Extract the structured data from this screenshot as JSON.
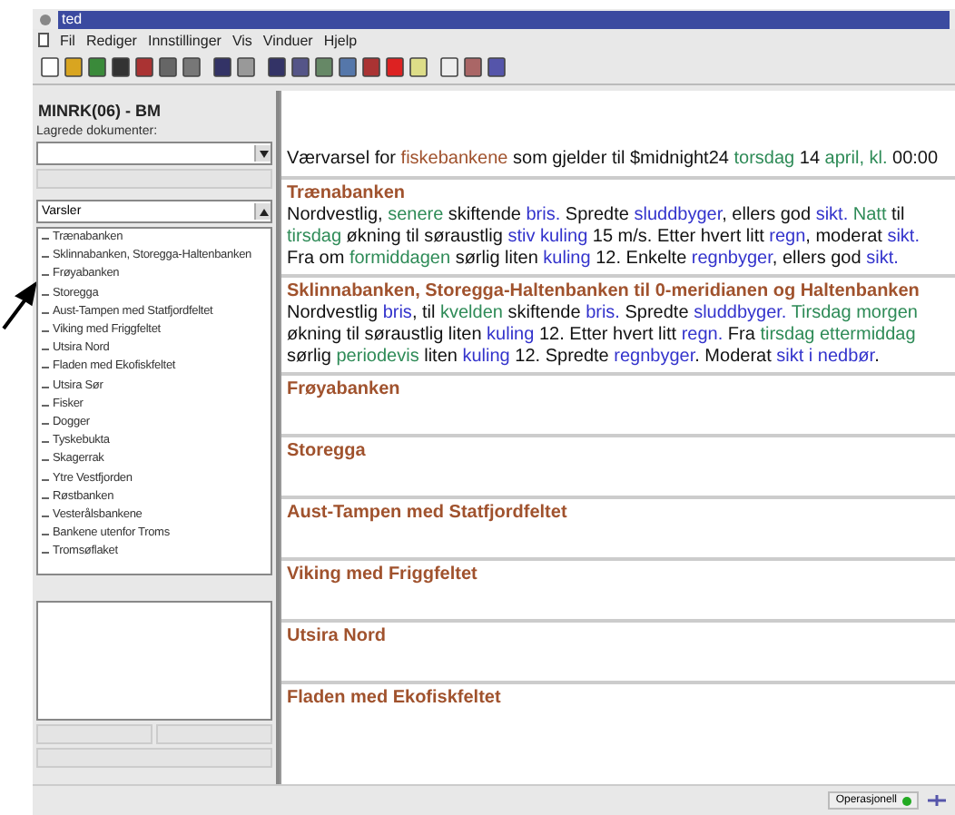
{
  "window": {
    "title": "ted"
  },
  "menu": [
    {
      "label": "Fil"
    },
    {
      "label": "Rediger"
    },
    {
      "label": "Innstillinger"
    },
    {
      "label": "Vis"
    },
    {
      "label": "Vinduer"
    },
    {
      "label": "Hjelp"
    }
  ],
  "sidebar": {
    "title": "MINRK(06) - BM",
    "saved_label": "Lagrede dokumenter:",
    "list_select": "Varsler",
    "tree": [
      {
        "label": "Trænabanken"
      },
      {
        "label": "Sklinnabanken, Storegga-Haltenbanken"
      },
      {
        "label": "Frøyabanken"
      },
      {
        "label": "Storegga"
      },
      {
        "label": "Aust-Tampen med Statfjordfeltet"
      },
      {
        "label": "Viking med Friggfeltet"
      },
      {
        "label": "Utsira Nord"
      },
      {
        "label": "Fladen med Ekofiskfeltet"
      },
      {
        "label": "Utsira Sør"
      },
      {
        "label": "Fisker"
      },
      {
        "label": "Dogger"
      },
      {
        "label": "Tyskebukta"
      },
      {
        "label": "Skagerrak"
      },
      {
        "label": "Ytre Vestfjorden"
      },
      {
        "label": "Røstbanken"
      },
      {
        "label": "Vesterålsbankene"
      },
      {
        "label": "Bankene utenfor Troms"
      },
      {
        "label": "Tromsøflaket"
      }
    ]
  },
  "document": {
    "intro": [
      {
        "kind": "plain",
        "text": "Værvarsel for "
      },
      {
        "kind": "place",
        "text": "fiskebankene"
      },
      {
        "kind": "plain",
        "text": " som gjelder til $midnight24 "
      },
      {
        "kind": "time",
        "text": "torsdag"
      },
      {
        "kind": "plain",
        "text": " 14 "
      },
      {
        "kind": "time",
        "text": "april, kl."
      },
      {
        "kind": "plain",
        "text": " 00:00"
      }
    ],
    "sections": [
      {
        "heading": "Trænabanken",
        "body": [
          {
            "kind": "plain",
            "text": "Nordvestlig, "
          },
          {
            "kind": "time",
            "text": "senere"
          },
          {
            "kind": "plain",
            "text": " skiftende "
          },
          {
            "kind": "term",
            "text": "bris."
          },
          {
            "kind": "plain",
            "text": " Spredte "
          },
          {
            "kind": "term",
            "text": "sluddbyger"
          },
          {
            "kind": "plain",
            "text": ", ellers god "
          },
          {
            "kind": "term",
            "text": "sikt."
          },
          {
            "kind": "time",
            "text": " Natt"
          },
          {
            "kind": "plain",
            "text": " til "
          },
          {
            "kind": "time",
            "text": "tirsdag"
          },
          {
            "kind": "plain",
            "text": " økning til søraustlig "
          },
          {
            "kind": "term",
            "text": "stiv kuling"
          },
          {
            "kind": "plain",
            "text": " 15 m/s. Etter hvert litt "
          },
          {
            "kind": "term",
            "text": "regn"
          },
          {
            "kind": "plain",
            "text": ", moderat "
          },
          {
            "kind": "term",
            "text": "sikt."
          },
          {
            "kind": "plain",
            "text": " Fra om "
          },
          {
            "kind": "time",
            "text": "formiddagen"
          },
          {
            "kind": "plain",
            "text": " sørlig liten "
          },
          {
            "kind": "term",
            "text": "kuling"
          },
          {
            "kind": "plain",
            "text": " 12. Enkelte "
          },
          {
            "kind": "term",
            "text": "regnbyger"
          },
          {
            "kind": "plain",
            "text": ", ellers god "
          },
          {
            "kind": "term",
            "text": "sikt."
          }
        ]
      },
      {
        "heading": "Sklinnabanken, Storegga-Haltenbanken til 0-meridianen og Haltenbanken",
        "body": [
          {
            "kind": "plain",
            "text": "Nordvestlig "
          },
          {
            "kind": "term",
            "text": "bris"
          },
          {
            "kind": "plain",
            "text": ", til "
          },
          {
            "kind": "time",
            "text": "kvelden"
          },
          {
            "kind": "plain",
            "text": " skiftende "
          },
          {
            "kind": "term",
            "text": "bris."
          },
          {
            "kind": "plain",
            "text": " Spredte "
          },
          {
            "kind": "term",
            "text": "sluddbyger."
          },
          {
            "kind": "time",
            "text": " Tirsdag morgen"
          },
          {
            "kind": "plain",
            "text": " økning til søraustlig liten "
          },
          {
            "kind": "term",
            "text": "kuling"
          },
          {
            "kind": "plain",
            "text": " 12. Etter hvert litt "
          },
          {
            "kind": "term",
            "text": "regn."
          },
          {
            "kind": "plain",
            "text": " Fra "
          },
          {
            "kind": "time",
            "text": "tirsdag ettermiddag"
          },
          {
            "kind": "plain",
            "text": " sørlig "
          },
          {
            "kind": "time",
            "text": "periodevis"
          },
          {
            "kind": "plain",
            "text": " liten "
          },
          {
            "kind": "term",
            "text": "kuling"
          },
          {
            "kind": "plain",
            "text": " 12. Spredte "
          },
          {
            "kind": "term",
            "text": "regnbyger"
          },
          {
            "kind": "plain",
            "text": ". Moderat "
          },
          {
            "kind": "term",
            "text": "sikt i nedbør"
          },
          {
            "kind": "plain",
            "text": "."
          }
        ]
      },
      {
        "heading": "Frøyabanken"
      },
      {
        "heading": "Storegga"
      },
      {
        "heading": "Aust-Tampen med Statfjordfeltet"
      },
      {
        "heading": "Viking med Friggfeltet"
      },
      {
        "heading": "Utsira Nord"
      },
      {
        "heading": "Fladen med Ekofiskfeltet"
      }
    ]
  },
  "status_bar": {
    "mode": "Operasjonell"
  }
}
